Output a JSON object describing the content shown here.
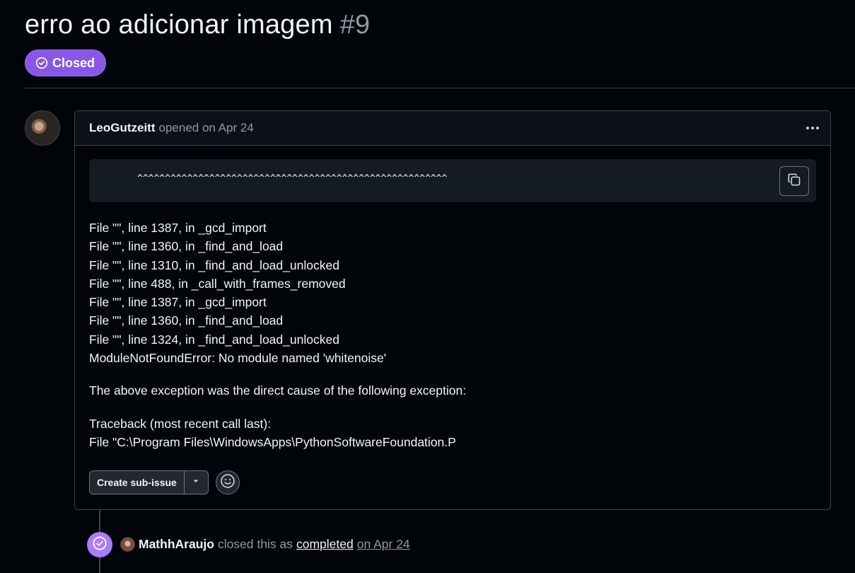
{
  "issue": {
    "title": "erro ao adicionar imagem",
    "number": "#9",
    "state": "Closed",
    "state_color": "#8957e5"
  },
  "comment": {
    "author": "LeoGutzeitt",
    "meta": "opened on Apr 24",
    "code_line": "^^^^^^^^^^^^^^^^^^^^^^^^^^^^^^^^^^^^^^^^^^^^^^^^^^^^^^^^",
    "lines": [
      "File \"\", line 1387, in _gcd_import",
      "File \"\", line 1360, in _find_and_load",
      "File \"\", line 1310, in _find_and_load_unlocked",
      "File \"\", line 488, in _call_with_frames_removed",
      "File \"\", line 1387, in _gcd_import",
      "File \"\", line 1360, in _find_and_load",
      "File \"\", line 1324, in _find_and_load_unlocked",
      "ModuleNotFoundError: No module named 'whitenoise'"
    ],
    "para2": "The above exception was the direct cause of the following exception:",
    "para3_lines": [
      "Traceback (most recent call last):",
      "File \"C:\\Program Files\\WindowsApps\\PythonSoftwareFoundation.P"
    ],
    "create_subissue_label": "Create sub-issue"
  },
  "event": {
    "actor": "MathhAraujo",
    "text": "closed this as",
    "link": "completed",
    "date": "on Apr 24",
    "icon_color": "#ab7df8"
  },
  "icons": {
    "state": "check-circle-icon",
    "copy": "copy-icon",
    "kebab": "kebab-horizontal-icon",
    "caret": "triangle-down-icon",
    "emoji": "smiley-icon",
    "closed": "check-circle-icon"
  }
}
